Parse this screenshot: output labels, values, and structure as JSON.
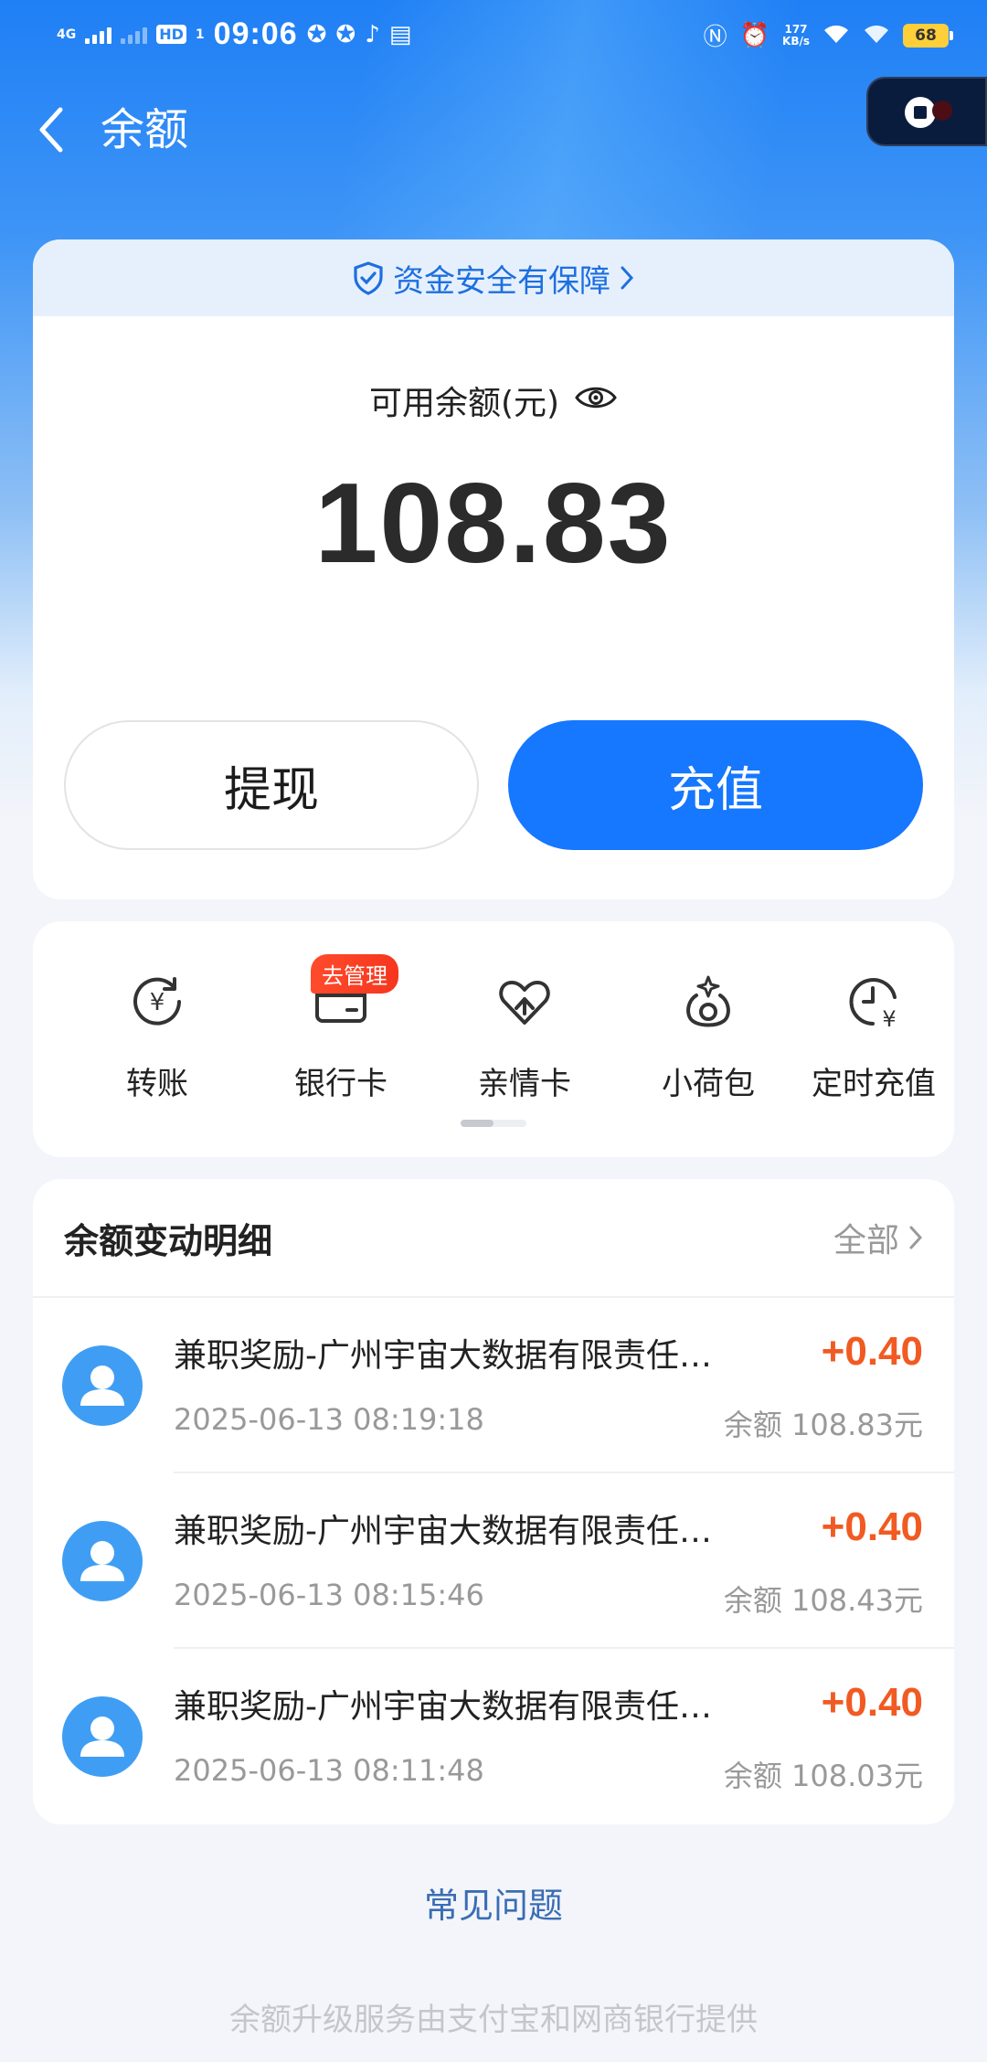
{
  "status_bar": {
    "network": "4G",
    "hd": "HD",
    "hd_sub": "1",
    "time": "09:06",
    "net_speed_value": "177",
    "net_speed_unit": "KB/s",
    "battery": "68"
  },
  "header": {
    "title": "余额"
  },
  "balance": {
    "security_text": "资金安全有保障",
    "label": "可用余额(元)",
    "amount": "108.83",
    "withdraw_label": "提现",
    "recharge_label": "充值"
  },
  "quick_actions": {
    "badge": "去管理",
    "items": [
      {
        "label": "转账",
        "icon": "transfer-icon"
      },
      {
        "label": "银行卡",
        "icon": "bank-card-icon"
      },
      {
        "label": "亲情卡",
        "icon": "family-card-icon"
      },
      {
        "label": "小荷包",
        "icon": "pouch-icon"
      },
      {
        "label": "定时充值",
        "icon": "scheduled-recharge-icon"
      }
    ]
  },
  "transactions": {
    "title": "余额变动明细",
    "filter_label": "全部",
    "items": [
      {
        "name": "兼职奖励-广州宇宙大数据有限责任…",
        "amount": "+0.40",
        "time": "2025-06-13 08:19:18",
        "balance": "余额 108.83元"
      },
      {
        "name": "兼职奖励-广州宇宙大数据有限责任…",
        "amount": "+0.40",
        "time": "2025-06-13 08:15:46",
        "balance": "余额 108.43元"
      },
      {
        "name": "兼职奖励-广州宇宙大数据有限责任…",
        "amount": "+0.40",
        "time": "2025-06-13 08:11:48",
        "balance": "余额 108.03元"
      }
    ]
  },
  "faq_label": "常见问题",
  "footer_note": "余额升级服务由支付宝和网商银行提供",
  "colors": {
    "primary": "#1677ff",
    "amount_positive": "#f15a22",
    "badge": "#f6361e"
  }
}
